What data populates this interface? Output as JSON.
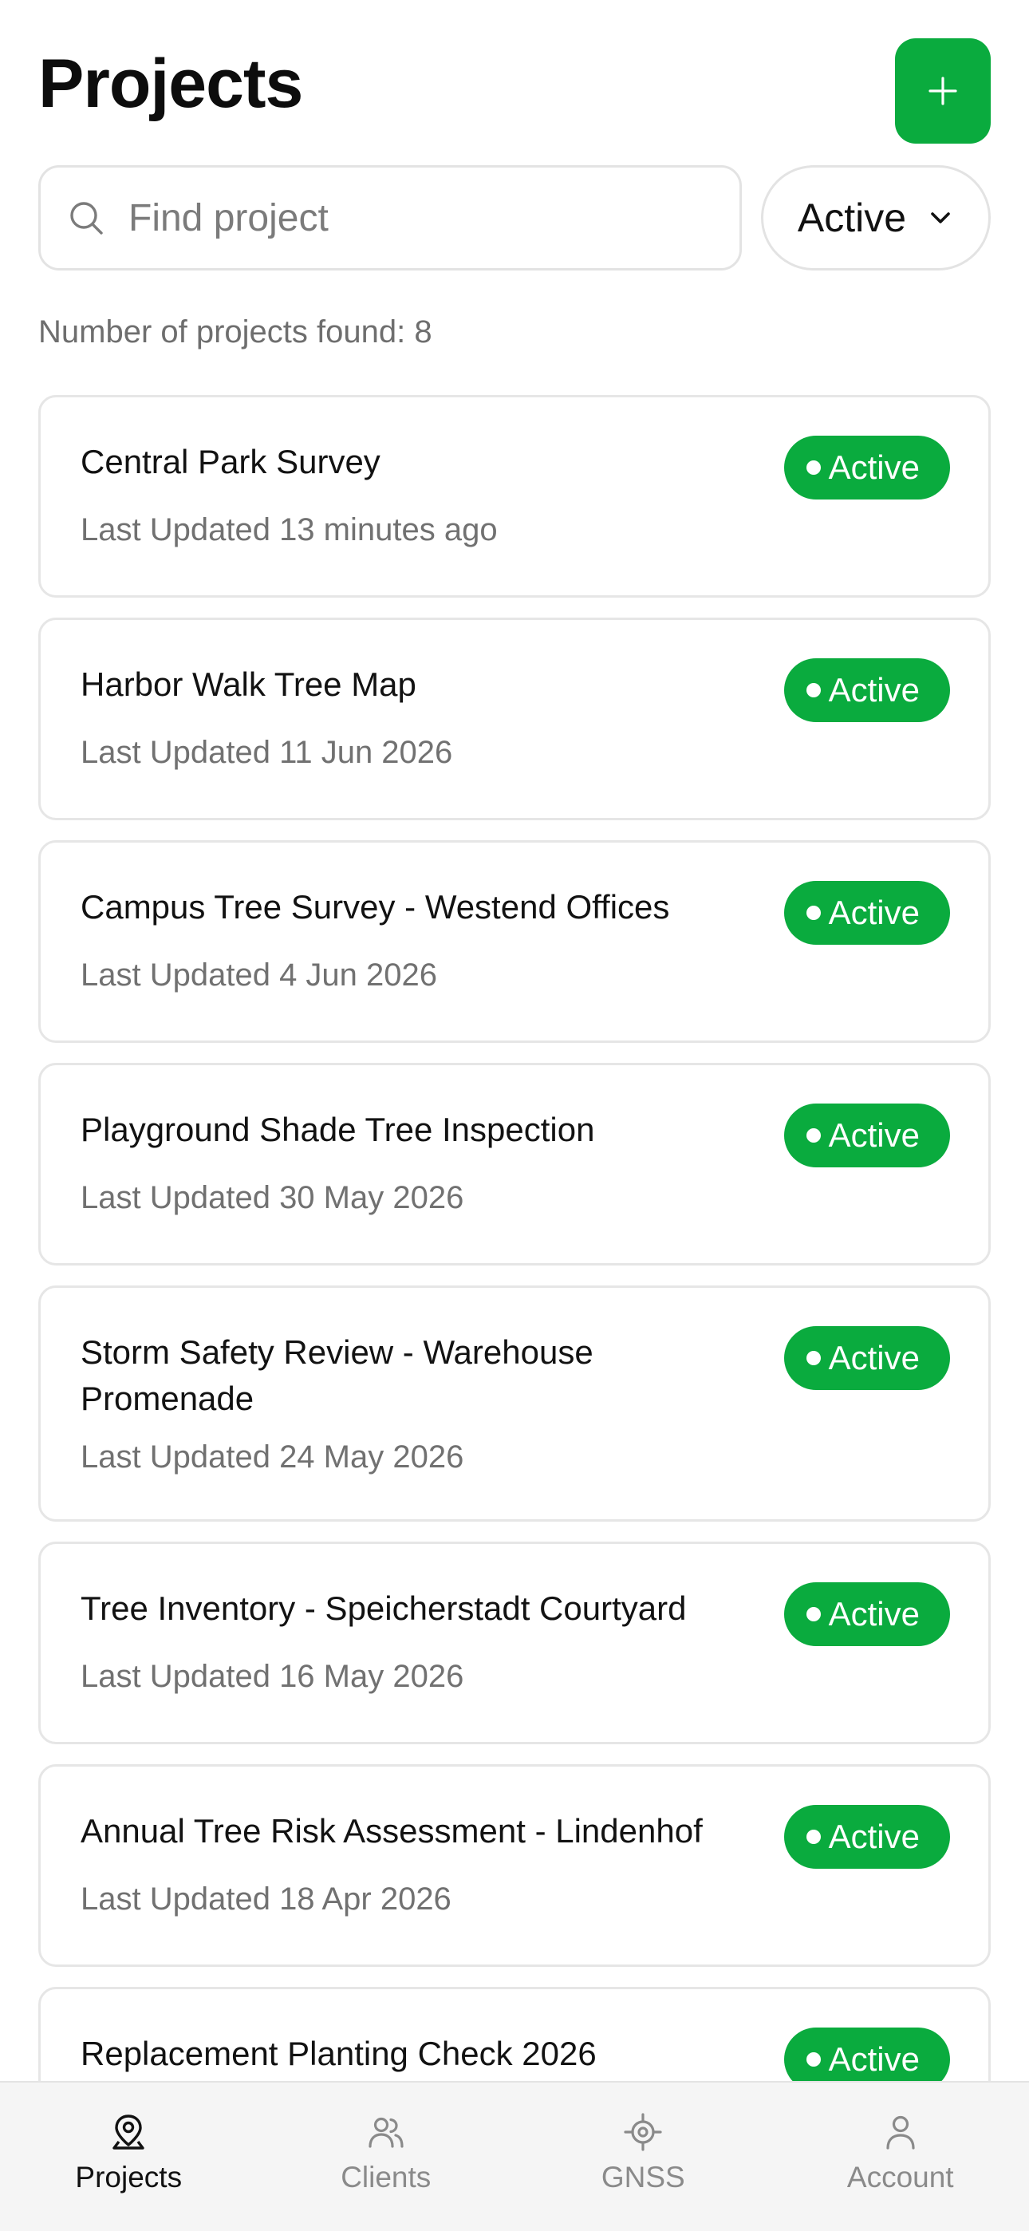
{
  "header": {
    "title": "Projects",
    "add_icon": "plus-icon"
  },
  "search": {
    "placeholder": "Find project",
    "value": "",
    "icon": "search-icon"
  },
  "filter": {
    "selected": "Active",
    "icon": "chevron-down-icon"
  },
  "result_count_text": "Number of projects found: 8",
  "projects": [
    {
      "name": "Central Park Survey",
      "updated": "Last Updated 13 minutes ago",
      "status": "Active"
    },
    {
      "name": "Harbor Walk Tree Map",
      "updated": "Last Updated 11 Jun 2026",
      "status": "Active"
    },
    {
      "name": "Campus Tree Survey - Westend Offices",
      "updated": "Last Updated 4 Jun 2026",
      "status": "Active"
    },
    {
      "name": "Playground Shade Tree Inspection",
      "updated": "Last Updated 30 May 2026",
      "status": "Active"
    },
    {
      "name": "Storm Safety Review - Warehouse Promenade",
      "updated": "Last Updated 24 May 2026",
      "status": "Active"
    },
    {
      "name": "Tree Inventory - Speicherstadt Courtyard",
      "updated": "Last Updated 16 May 2026",
      "status": "Active"
    },
    {
      "name": "Annual Tree Risk Assessment - Lindenhof",
      "updated": "Last Updated 18 Apr 2026",
      "status": "Active"
    },
    {
      "name": "Replacement Planting Check 2026",
      "updated": "",
      "status": "Active"
    }
  ],
  "tabs": [
    {
      "label": "Projects",
      "icon": "map-pin-icon",
      "active": true
    },
    {
      "label": "Clients",
      "icon": "users-icon",
      "active": false
    },
    {
      "label": "GNSS",
      "icon": "crosshair-icon",
      "active": false
    },
    {
      "label": "Account",
      "icon": "user-icon",
      "active": false
    }
  ],
  "colors": {
    "accent": "#0aab3e",
    "badge_text": "#ffffff",
    "muted_text": "#717171",
    "card_border": "#e6e6e6"
  }
}
